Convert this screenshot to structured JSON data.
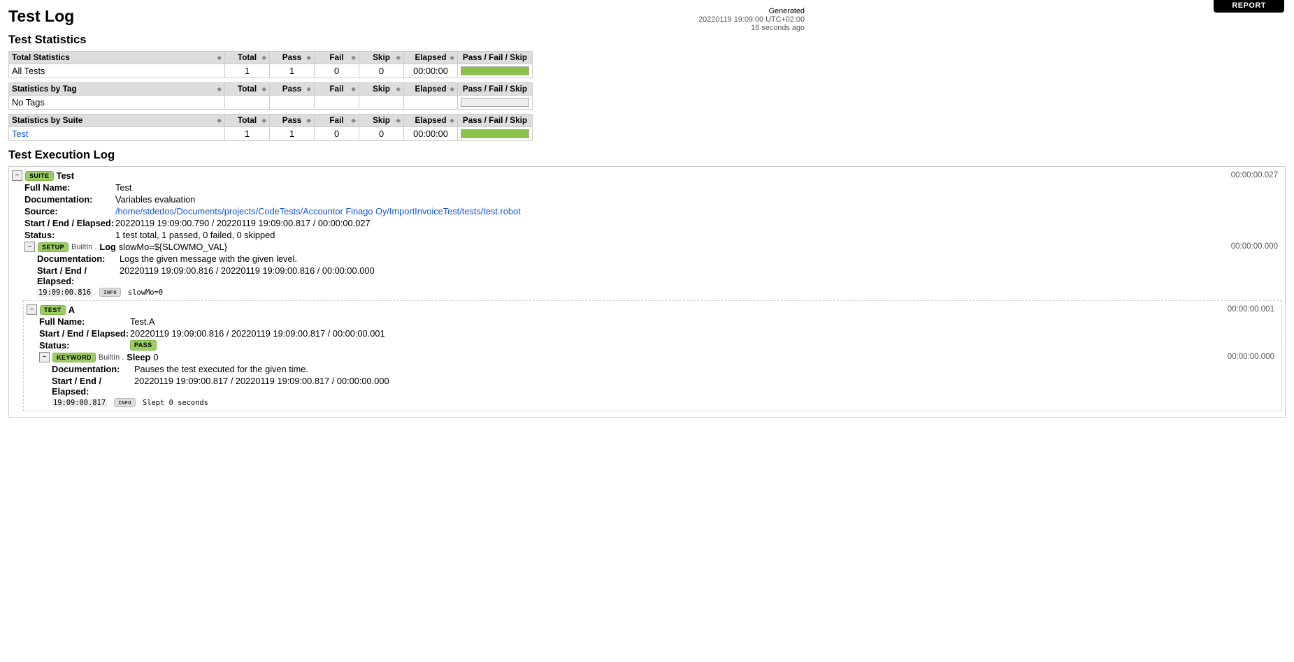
{
  "report_link_label": "REPORT",
  "title": "Test Log",
  "generated": {
    "label": "Generated",
    "timestamp": "20220119 19:09:00 UTC+02:00",
    "ago": "16 seconds ago"
  },
  "stats_heading": "Test Statistics",
  "stats_tables": [
    {
      "name_header": "Total Statistics",
      "headers": [
        "Total",
        "Pass",
        "Fail",
        "Skip",
        "Elapsed",
        "Pass / Fail / Skip"
      ],
      "rows": [
        {
          "name": "All Tests",
          "is_link": false,
          "total": "1",
          "pass": "1",
          "fail": "0",
          "skip": "0",
          "elapsed": "00:00:00",
          "graph": {
            "pass": 100,
            "fail": 0,
            "skip": 0
          }
        }
      ]
    },
    {
      "name_header": "Statistics by Tag",
      "headers": [
        "Total",
        "Pass",
        "Fail",
        "Skip",
        "Elapsed",
        "Pass / Fail / Skip"
      ],
      "rows": [
        {
          "name": "No Tags",
          "is_link": false,
          "total": "",
          "pass": "",
          "fail": "",
          "skip": "",
          "elapsed": "",
          "graph": {
            "empty": true
          }
        }
      ]
    },
    {
      "name_header": "Statistics by Suite",
      "headers": [
        "Total",
        "Pass",
        "Fail",
        "Skip",
        "Elapsed",
        "Pass / Fail / Skip"
      ],
      "rows": [
        {
          "name": "Test",
          "is_link": true,
          "total": "1",
          "pass": "1",
          "fail": "0",
          "skip": "0",
          "elapsed": "00:00:00",
          "graph": {
            "pass": 100,
            "fail": 0,
            "skip": 0
          }
        }
      ]
    }
  ],
  "exec_heading": "Test Execution Log",
  "suite": {
    "label": "SUITE",
    "name": "Test",
    "elapsed": "00:00:00.027",
    "meta": {
      "full_name_key": "Full Name:",
      "full_name": "Test",
      "doc_key": "Documentation:",
      "doc": "Variables evaluation",
      "source_key": "Source:",
      "source": "/home/stdedos/Documents/projects/CodeTests/Accountor Finago Oy/ImportInvoiceTest/tests/test.robot",
      "times_key": "Start / End / Elapsed:",
      "times": "20220119 19:09:00.790 / 20220119 19:09:00.817 / 00:00:00.027",
      "status_key": "Status:",
      "status": "1 test total, 1 passed, 0 failed, 0 skipped"
    },
    "setup": {
      "label": "SETUP",
      "lib": "BuiltIn .",
      "kw": "Log",
      "args": "slowMo=${SLOWMO_VAL}",
      "elapsed": "00:00:00.000",
      "doc_key": "Documentation:",
      "doc": "Logs the given message with the given level.",
      "times_key": "Start / End / Elapsed:",
      "times": "20220119 19:09:00.816 / 20220119 19:09:00.816 / 00:00:00.000",
      "msg_ts": "19:09:00.816",
      "msg_level": "INFO",
      "msg_text": "slowMo=0"
    },
    "test": {
      "label": "TEST",
      "name": "A",
      "elapsed": "00:00:00.001",
      "full_name_key": "Full Name:",
      "full_name": "Test.A",
      "times_key": "Start / End / Elapsed:",
      "times": "20220119 19:09:00.816 / 20220119 19:09:00.817 / 00:00:00.001",
      "status_key": "Status:",
      "status_label": "PASS",
      "kw": {
        "label": "KEYWORD",
        "lib": "BuiltIn .",
        "name": "Sleep",
        "args": "0",
        "elapsed": "00:00:00.000",
        "doc_key": "Documentation:",
        "doc": "Pauses the test executed for the given time.",
        "times_key": "Start / End / Elapsed:",
        "times": "20220119 19:09:00.817 / 20220119 19:09:00.817 / 00:00:00.000",
        "msg_ts": "19:09:00.817",
        "msg_level": "INFO",
        "msg_text": "Slept 0 seconds"
      }
    }
  }
}
